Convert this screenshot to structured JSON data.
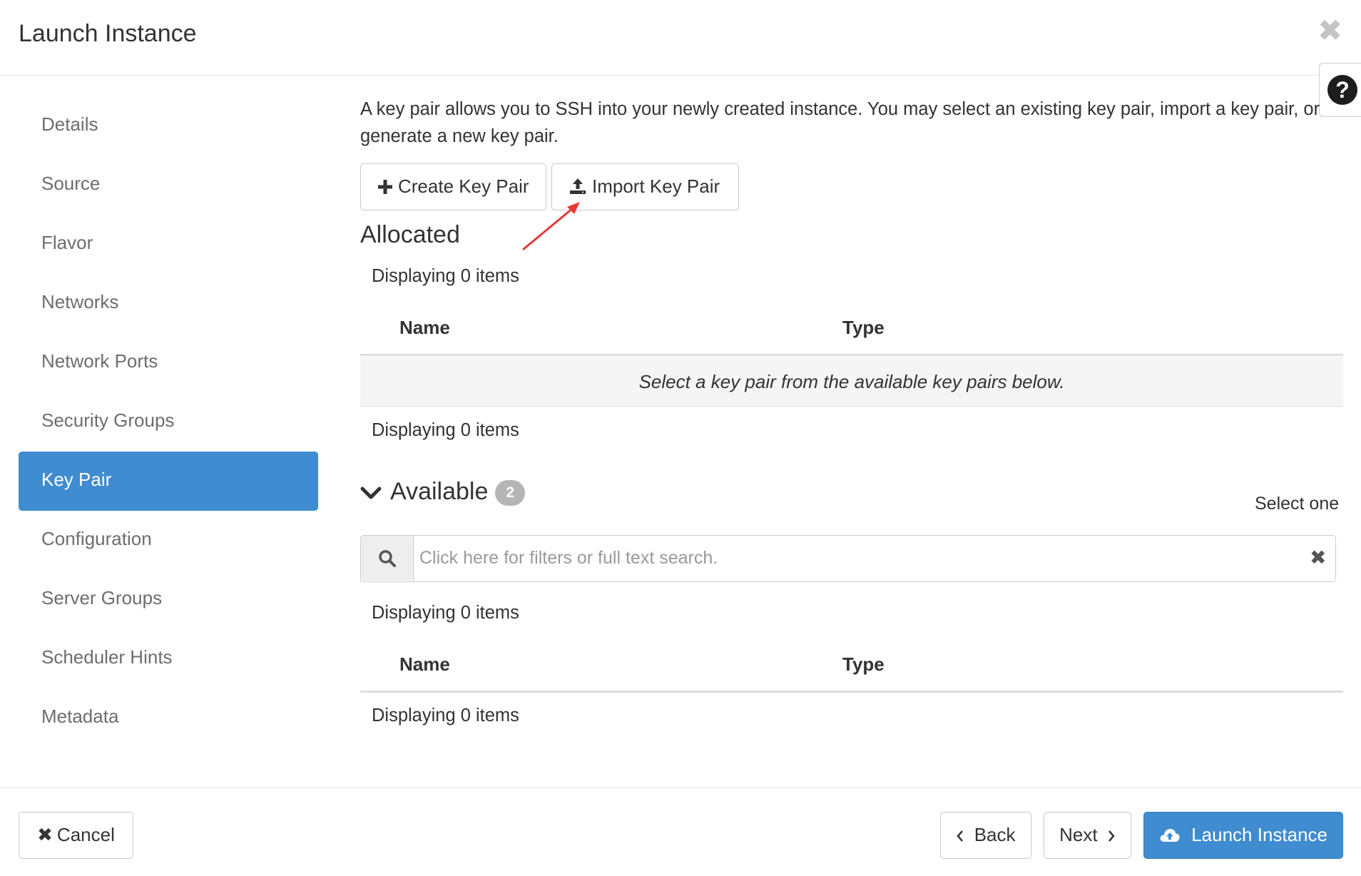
{
  "header": {
    "title": "Launch Instance",
    "close_glyph": "✖",
    "help_glyph": "?"
  },
  "sidebar": {
    "items": [
      {
        "label": "Details"
      },
      {
        "label": "Source"
      },
      {
        "label": "Flavor"
      },
      {
        "label": "Networks"
      },
      {
        "label": "Network Ports"
      },
      {
        "label": "Security Groups"
      },
      {
        "label": "Key Pair",
        "active": true
      },
      {
        "label": "Configuration"
      },
      {
        "label": "Server Groups"
      },
      {
        "label": "Scheduler Hints"
      },
      {
        "label": "Metadata"
      }
    ]
  },
  "main": {
    "intro": "A key pair allows you to SSH into your newly created instance. You may select an existing key pair, import a key pair, or generate a new key pair.",
    "create_button": {
      "icon": "plus-icon",
      "label": "Create Key Pair"
    },
    "import_button": {
      "icon": "upload-icon",
      "label": "Import Key Pair"
    },
    "allocated": {
      "title": "Allocated",
      "displaying_top": "Displaying 0 items",
      "columns": [
        "Name",
        "Type"
      ],
      "empty_message": "Select a key pair from the available key pairs below.",
      "displaying_bottom": "Displaying 0 items"
    },
    "available": {
      "title": "Available",
      "count": "2",
      "select_hint": "Select one",
      "search_placeholder": "Click here for filters or full text search.",
      "displaying_top": "Displaying 0 items",
      "columns": [
        "Name",
        "Type"
      ],
      "displaying_bottom": "Displaying 0 items"
    }
  },
  "footer": {
    "cancel_label": "Cancel",
    "back_label": "Back",
    "next_label": "Next",
    "launch_label": "Launch Instance"
  },
  "colors": {
    "accent": "#3f8cd0",
    "annotation_arrow": "#e53935"
  }
}
